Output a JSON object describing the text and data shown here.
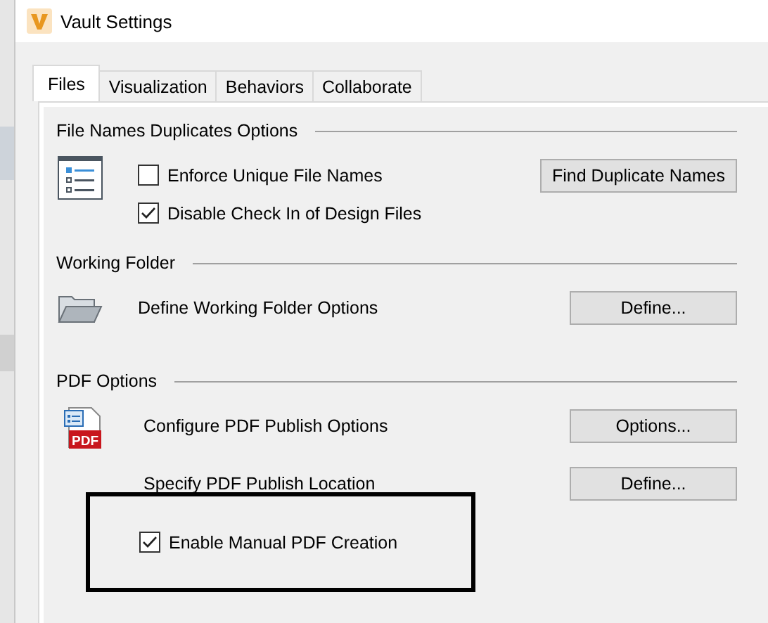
{
  "window": {
    "title": "Vault Settings"
  },
  "tabs": [
    {
      "label": "Files",
      "selected": true
    },
    {
      "label": "Visualization",
      "selected": false
    },
    {
      "label": "Behaviors",
      "selected": false
    },
    {
      "label": "Collaborate",
      "selected": false
    }
  ],
  "sections": [
    {
      "title": "File Names Duplicates Options",
      "kind": "list",
      "rows": [
        {
          "kind": "checkbox",
          "label": "Enforce Unique File Names",
          "checked": false,
          "button": "Find Duplicate Names"
        },
        {
          "kind": "checkbox",
          "label": "Disable Check In of Design Files",
          "checked": true
        }
      ]
    },
    {
      "title": "Working Folder",
      "kind": "folder",
      "rows": [
        {
          "kind": "action",
          "label": "Define Working Folder Options",
          "button": "Define..."
        }
      ]
    },
    {
      "title": "PDF Options",
      "kind": "pdf",
      "icon_label": "PDF",
      "rows": [
        {
          "kind": "action",
          "label": "Configure PDF Publish Options",
          "button": "Options..."
        },
        {
          "kind": "action",
          "label": "Specify PDF Publish Location",
          "button": "Define..."
        },
        {
          "kind": "checkbox",
          "label": "Enable Manual PDF Creation",
          "checked": true,
          "highlighted": true
        }
      ]
    }
  ]
}
